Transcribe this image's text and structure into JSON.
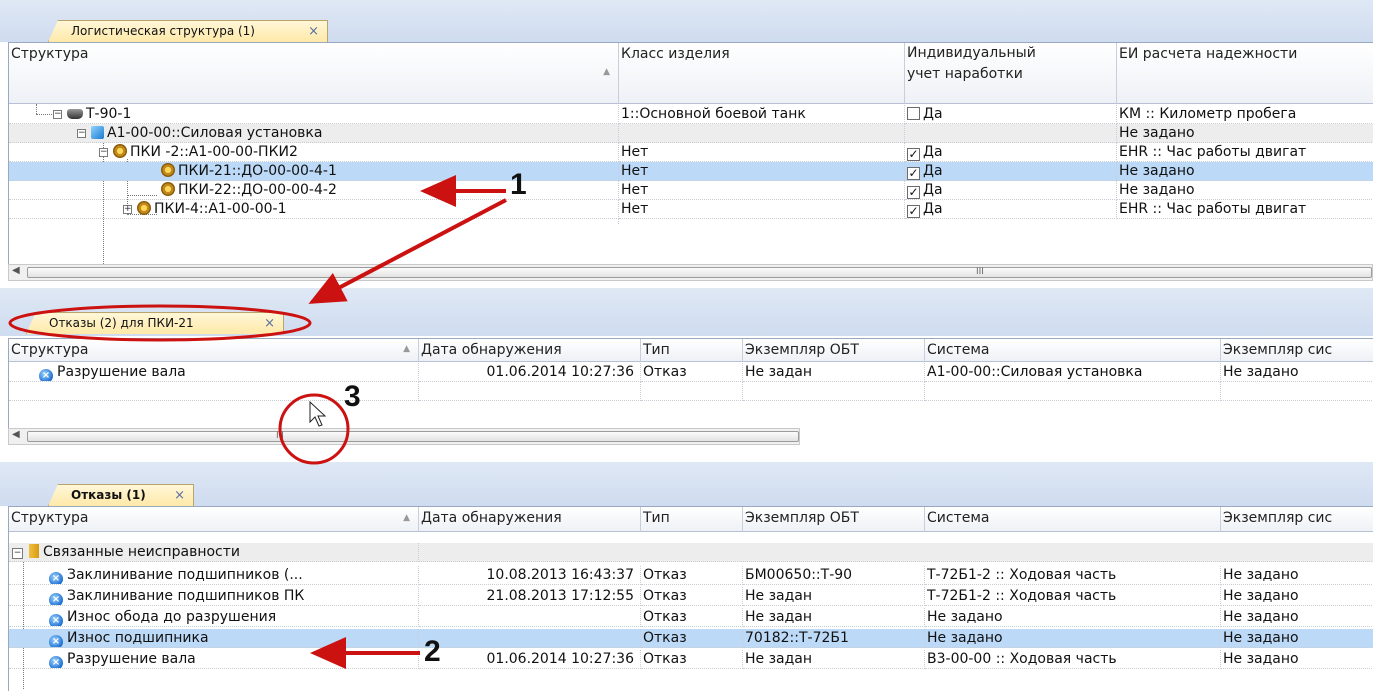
{
  "panel1": {
    "tab": "Логистическая структура (1)",
    "close": "×",
    "headers": [
      "Структура",
      "Класс изделия",
      "Индивидуальный",
      "учет наработки",
      "ЕИ расчета надежности"
    ],
    "rows": [
      {
        "name": "Т-90-1",
        "cls": "1::Основной боевой танк",
        "chk": "",
        "ind": "Да",
        "ei": "КМ :: Километр пробега"
      },
      {
        "name": "А1-00-00::Силовая установка",
        "cls": "",
        "chk": "",
        "ind": "",
        "ei": "Не задано"
      },
      {
        "name": "ПКИ -2::А1-00-00-ПКИ2",
        "cls": "Нет",
        "chk": "✓",
        "ind": "Да",
        "ei": "EHR :: Час работы двигат"
      },
      {
        "name": "ПКИ-21::ДО-00-00-4-1",
        "cls": "Нет",
        "chk": "✓",
        "ind": "Да",
        "ei": "Не задано"
      },
      {
        "name": "ПКИ-22::ДО-00-00-4-2",
        "cls": "Нет",
        "chk": "✓",
        "ind": "Да",
        "ei": "Не задано"
      },
      {
        "name": "ПКИ-4::А1-00-00-1",
        "cls": "Нет",
        "chk": "✓",
        "ind": "Да",
        "ei": "EHR :: Час работы двигат"
      }
    ],
    "scroll_grip": "III"
  },
  "panel2": {
    "tab": "Отказы (2) для ПКИ-21",
    "close": "×",
    "headers": [
      "Структура",
      "Дата обнаружения",
      "Тип",
      "Экземпляр ОБТ",
      "Система",
      "Экземпляр сис"
    ],
    "rows": [
      {
        "name": "Разрушение вала",
        "date": "01.06.2014 10:27:36",
        "type": "Отказ",
        "obt": "Не задан",
        "sys": "А1-00-00::Силовая установка",
        "inst": "Не задано"
      }
    ],
    "scroll_grip": "III"
  },
  "panel3": {
    "tab": "Отказы (1)",
    "close": "×",
    "headers": [
      "Структура",
      "Дата обнаружения",
      "Тип",
      "Экземпляр ОБТ",
      "Система",
      "Экземпляр сис"
    ],
    "group": "Связанные неисправности",
    "rows": [
      {
        "name": "Заклинивание подшипников (...",
        "date": "10.08.2013 16:43:37",
        "type": "Отказ",
        "obt": "БМ00650::Т-90",
        "sys": "Т-72Б1-2 :: Ходовая часть",
        "inst": "Не задано"
      },
      {
        "name": "Заклинивание подшипников ПК",
        "date": "21.08.2013 17:12:55",
        "type": "Отказ",
        "obt": "Не задан",
        "sys": "Т-72Б1-2 :: Ходовая часть",
        "inst": "Не задано"
      },
      {
        "name": "Износ обода до разрушения",
        "date": "",
        "type": "Отказ",
        "obt": "Не задан",
        "sys": "Не задано",
        "inst": "Не задано"
      },
      {
        "name": "Износ подшипника",
        "date": "",
        "type": "Отказ",
        "obt": "70182::Т-72Б1",
        "sys": "Не задано",
        "inst": "Не задано"
      },
      {
        "name": "Разрушение вала",
        "date": "01.06.2014 10:27:36",
        "type": "Отказ",
        "obt": "Не задан",
        "sys": "В3-00-00 :: Ходовая часть",
        "inst": "Не задано"
      }
    ]
  },
  "callouts": [
    "1",
    "2",
    "3"
  ],
  "colors": {
    "selection": "#bcd9f7",
    "annotation_red": "#cc1111"
  }
}
